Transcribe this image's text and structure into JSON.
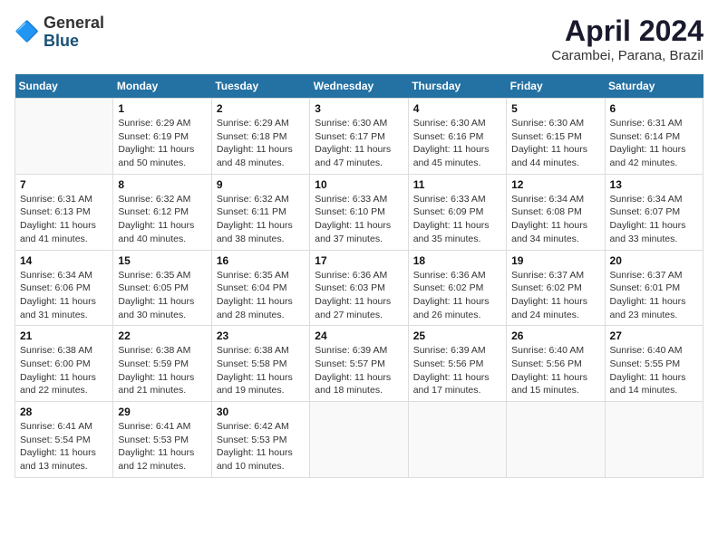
{
  "logo": {
    "general": "General",
    "blue": "Blue"
  },
  "header": {
    "month_year": "April 2024",
    "location": "Carambei, Parana, Brazil"
  },
  "days_of_week": [
    "Sunday",
    "Monday",
    "Tuesday",
    "Wednesday",
    "Thursday",
    "Friday",
    "Saturday"
  ],
  "weeks": [
    [
      {
        "day": "",
        "content": ""
      },
      {
        "day": "1",
        "content": "Sunrise: 6:29 AM\nSunset: 6:19 PM\nDaylight: 11 hours\nand 50 minutes."
      },
      {
        "day": "2",
        "content": "Sunrise: 6:29 AM\nSunset: 6:18 PM\nDaylight: 11 hours\nand 48 minutes."
      },
      {
        "day": "3",
        "content": "Sunrise: 6:30 AM\nSunset: 6:17 PM\nDaylight: 11 hours\nand 47 minutes."
      },
      {
        "day": "4",
        "content": "Sunrise: 6:30 AM\nSunset: 6:16 PM\nDaylight: 11 hours\nand 45 minutes."
      },
      {
        "day": "5",
        "content": "Sunrise: 6:30 AM\nSunset: 6:15 PM\nDaylight: 11 hours\nand 44 minutes."
      },
      {
        "day": "6",
        "content": "Sunrise: 6:31 AM\nSunset: 6:14 PM\nDaylight: 11 hours\nand 42 minutes."
      }
    ],
    [
      {
        "day": "7",
        "content": "Sunrise: 6:31 AM\nSunset: 6:13 PM\nDaylight: 11 hours\nand 41 minutes."
      },
      {
        "day": "8",
        "content": "Sunrise: 6:32 AM\nSunset: 6:12 PM\nDaylight: 11 hours\nand 40 minutes."
      },
      {
        "day": "9",
        "content": "Sunrise: 6:32 AM\nSunset: 6:11 PM\nDaylight: 11 hours\nand 38 minutes."
      },
      {
        "day": "10",
        "content": "Sunrise: 6:33 AM\nSunset: 6:10 PM\nDaylight: 11 hours\nand 37 minutes."
      },
      {
        "day": "11",
        "content": "Sunrise: 6:33 AM\nSunset: 6:09 PM\nDaylight: 11 hours\nand 35 minutes."
      },
      {
        "day": "12",
        "content": "Sunrise: 6:34 AM\nSunset: 6:08 PM\nDaylight: 11 hours\nand 34 minutes."
      },
      {
        "day": "13",
        "content": "Sunrise: 6:34 AM\nSunset: 6:07 PM\nDaylight: 11 hours\nand 33 minutes."
      }
    ],
    [
      {
        "day": "14",
        "content": "Sunrise: 6:34 AM\nSunset: 6:06 PM\nDaylight: 11 hours\nand 31 minutes."
      },
      {
        "day": "15",
        "content": "Sunrise: 6:35 AM\nSunset: 6:05 PM\nDaylight: 11 hours\nand 30 minutes."
      },
      {
        "day": "16",
        "content": "Sunrise: 6:35 AM\nSunset: 6:04 PM\nDaylight: 11 hours\nand 28 minutes."
      },
      {
        "day": "17",
        "content": "Sunrise: 6:36 AM\nSunset: 6:03 PM\nDaylight: 11 hours\nand 27 minutes."
      },
      {
        "day": "18",
        "content": "Sunrise: 6:36 AM\nSunset: 6:02 PM\nDaylight: 11 hours\nand 26 minutes."
      },
      {
        "day": "19",
        "content": "Sunrise: 6:37 AM\nSunset: 6:02 PM\nDaylight: 11 hours\nand 24 minutes."
      },
      {
        "day": "20",
        "content": "Sunrise: 6:37 AM\nSunset: 6:01 PM\nDaylight: 11 hours\nand 23 minutes."
      }
    ],
    [
      {
        "day": "21",
        "content": "Sunrise: 6:38 AM\nSunset: 6:00 PM\nDaylight: 11 hours\nand 22 minutes."
      },
      {
        "day": "22",
        "content": "Sunrise: 6:38 AM\nSunset: 5:59 PM\nDaylight: 11 hours\nand 21 minutes."
      },
      {
        "day": "23",
        "content": "Sunrise: 6:38 AM\nSunset: 5:58 PM\nDaylight: 11 hours\nand 19 minutes."
      },
      {
        "day": "24",
        "content": "Sunrise: 6:39 AM\nSunset: 5:57 PM\nDaylight: 11 hours\nand 18 minutes."
      },
      {
        "day": "25",
        "content": "Sunrise: 6:39 AM\nSunset: 5:56 PM\nDaylight: 11 hours\nand 17 minutes."
      },
      {
        "day": "26",
        "content": "Sunrise: 6:40 AM\nSunset: 5:56 PM\nDaylight: 11 hours\nand 15 minutes."
      },
      {
        "day": "27",
        "content": "Sunrise: 6:40 AM\nSunset: 5:55 PM\nDaylight: 11 hours\nand 14 minutes."
      }
    ],
    [
      {
        "day": "28",
        "content": "Sunrise: 6:41 AM\nSunset: 5:54 PM\nDaylight: 11 hours\nand 13 minutes."
      },
      {
        "day": "29",
        "content": "Sunrise: 6:41 AM\nSunset: 5:53 PM\nDaylight: 11 hours\nand 12 minutes."
      },
      {
        "day": "30",
        "content": "Sunrise: 6:42 AM\nSunset: 5:53 PM\nDaylight: 11 hours\nand 10 minutes."
      },
      {
        "day": "",
        "content": ""
      },
      {
        "day": "",
        "content": ""
      },
      {
        "day": "",
        "content": ""
      },
      {
        "day": "",
        "content": ""
      }
    ]
  ]
}
